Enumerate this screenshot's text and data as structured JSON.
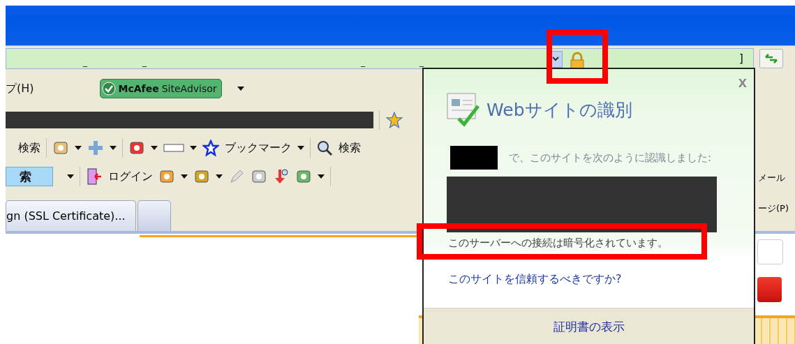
{
  "address_bar": {
    "marks": [
      "_",
      "_",
      "_",
      "_"
    ],
    "end_text": "]"
  },
  "menu": {
    "item": "プ(H)",
    "siteadvisor": {
      "brand": "McAfee",
      "product": "SiteAdvisor"
    }
  },
  "toolbar_search": {
    "search_label": "検索",
    "bookmarks": "ブックマーク",
    "search_button": "検索"
  },
  "toolbar_login": {
    "search_field_value": "索",
    "login": "ログイン",
    "mail": "メール"
  },
  "tabs": [
    {
      "label": "gn (SSL Certificate)...",
      "selected": true
    },
    {
      "selected": false
    }
  ],
  "page_menu": "ージ(P)",
  "popup": {
    "title": "Webサイトの識別",
    "close": "x",
    "identified_text": "で、このサイトを次のように認識しました:",
    "encryption_text": "このサーバーへの接続は暗号化されています。",
    "trust_link": "このサイトを信頼するべきですか?",
    "footer_button": "証明書の表示"
  },
  "annotations": [
    {
      "kind": "box"
    },
    {
      "kind": "box"
    }
  ]
}
